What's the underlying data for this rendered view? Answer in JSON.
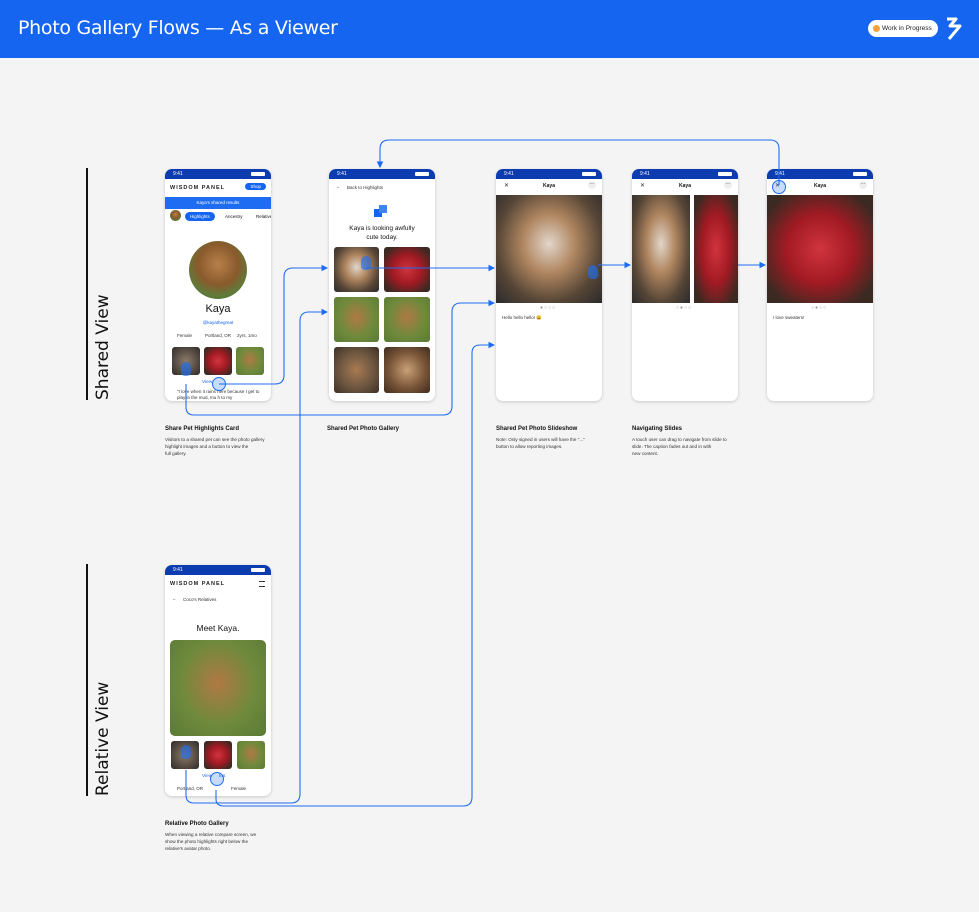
{
  "header": {
    "title": "Photo Gallery Flows —  As a Viewer",
    "badge": "Work in Progress",
    "brand_color": "#1565f0"
  },
  "sections": {
    "shared": "Shared View",
    "relative": "Relative View"
  },
  "phones": {
    "status_time": "9:41",
    "highlights": {
      "brand": "WISDOM PANEL",
      "shop": "Shop",
      "banner": "Kaya's shared results",
      "tabs": [
        "Highlights",
        "Ancestry",
        "Relative"
      ],
      "pet_name": "Kaya",
      "handle": "@kayathegreat",
      "meta": [
        "Female",
        "Portland, OR",
        "2yrs, 1mo"
      ],
      "link": "View",
      "quote": "\"I love when it rains here because I get to play in the mud, mu h to my"
    },
    "gallery": {
      "back": "Back to Highlights",
      "headline_1": "Kaya is looking awfully",
      "headline_2": "cute today."
    },
    "slideshow": {
      "nav_title": "Kaya",
      "caption": "Hello hello hello! 😀"
    },
    "navigating": {
      "nav_title": "Kaya"
    },
    "final": {
      "nav_title": "Kaya",
      "caption": "I love sweaters!"
    },
    "relative": {
      "brand": "WISDOM PANEL",
      "back": "Coco's Relatives",
      "headline": "Meet Kaya.",
      "link": "View",
      "link_tail": "tos",
      "meta": [
        "Portland, OR",
        "Female"
      ]
    }
  },
  "captions": [
    {
      "title": "Share Pet Highlights Card",
      "body": [
        "Visitors to a shared pet can see the photo gallery",
        "highlight images and a button to view the",
        "full gallery."
      ]
    },
    {
      "title": "Shared Pet Photo Gallery",
      "body": []
    },
    {
      "title": "Shared Pet Photo Slideshow",
      "body": [
        "Note: Only signed in users will have the \"...\"",
        "button to allow reporting images."
      ]
    },
    {
      "title": "Navigating Slides",
      "body": [
        "A touch user can drag to navigate from slide to",
        "slide. The caption fades out and in with",
        "new content."
      ]
    },
    {
      "title": "Relative Photo Gallery",
      "body": [
        "When viewing a relative compare screen, we",
        "show the photo highlights right below the",
        "relative's avatar photo."
      ]
    }
  ]
}
